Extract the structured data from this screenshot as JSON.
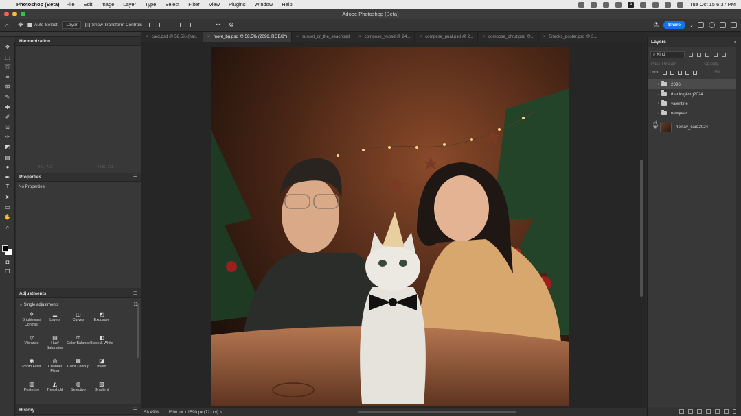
{
  "menubar": {
    "app": "Photoshop (Beta)",
    "items": [
      "File",
      "Edit",
      "mage",
      "Layer",
      "Type",
      "Select",
      "Filter",
      "View",
      "Plugins",
      "Window",
      "Help"
    ],
    "clock": "Tue Oct 15  6:37 PM"
  },
  "window": {
    "title": "Adobe Photoshop (Beta)"
  },
  "options": {
    "auto_select_label": "Auto-Select:",
    "auto_select_target": "Layer",
    "transform_label": "Show Transform Controls",
    "more": "•••",
    "share": "Share"
  },
  "tabs": [
    {
      "label": "card.psd @ 58.5% (har..."
    },
    {
      "label": "more_bg.psd @ 58.5% (2096, RGB/8*)"
    },
    {
      "label": "sunset_or_the_seachpsd"
    },
    {
      "label": "compose_yupsd @ 24..."
    },
    {
      "label": "compese_pual.psd @ 2..."
    },
    {
      "label": "comoose_chrut.psd @..."
    },
    {
      "label": "5nacks_poster.psd @ 3..."
    }
  ],
  "panels": {
    "harmonization": {
      "title": "Harmonization",
      "coord_left": "441, 712",
      "coord_right": "4446, 712"
    },
    "properties": {
      "title": "Properties",
      "empty": "No Properties"
    },
    "adjustments": {
      "title": "Adjustments",
      "section": "Single adjustments",
      "items": [
        {
          "label": "Brightness/ Contrast",
          "icon": "sun-icon",
          "glyph": "✲"
        },
        {
          "label": "Levels",
          "icon": "levels-icon",
          "glyph": "▂"
        },
        {
          "label": "Curves",
          "icon": "curves-icon",
          "glyph": "◫"
        },
        {
          "label": "Exposure",
          "icon": "exposure-icon",
          "glyph": "◩"
        },
        {
          "label": "Vibrance",
          "icon": "vibrance-icon",
          "glyph": "▽"
        },
        {
          "label": "Hue/ Saturation",
          "icon": "hue-icon",
          "glyph": "▤"
        },
        {
          "label": "Color Balance",
          "icon": "balance-icon",
          "glyph": "⚖"
        },
        {
          "label": "Black & White",
          "icon": "bw-icon",
          "glyph": "◧"
        },
        {
          "label": "Photo Filter",
          "icon": "photo-filter-icon",
          "glyph": "◉"
        },
        {
          "label": "Channel Mixer",
          "icon": "channel-mixer-icon",
          "glyph": "◎"
        },
        {
          "label": "Color Lookup",
          "icon": "color-lookup-icon",
          "glyph": "▦"
        },
        {
          "label": "Invert",
          "icon": "invert-icon",
          "glyph": "◪"
        },
        {
          "label": "Posterize",
          "icon": "posterize-icon",
          "glyph": "▥"
        },
        {
          "label": "Threshold",
          "icon": "threshold-icon",
          "glyph": "◭"
        },
        {
          "label": "Selective",
          "icon": "selective-icon",
          "glyph": "◍"
        },
        {
          "label": "Gradient",
          "icon": "gradient-icon",
          "glyph": "▧"
        }
      ]
    },
    "history": {
      "title": "History"
    }
  },
  "status": {
    "zoom": "58.49%",
    "doc": "1590 px x 1590 px (72 ppi)"
  },
  "layers": {
    "title": "Layers",
    "kind": "Kind",
    "blend": "Pass Through",
    "opacity": "Opacity:",
    "lock": "Lock:",
    "fill": "Fill:",
    "items": [
      {
        "name": "2096",
        "type": "group",
        "selected": true
      },
      {
        "name": "thanksgivirg2024",
        "type": "group",
        "selected": false
      },
      {
        "name": "valentine",
        "type": "group",
        "selected": false
      },
      {
        "name": "newyear",
        "type": "group",
        "selected": false
      },
      {
        "name": "holkav_card2024",
        "type": "image",
        "selected": false
      }
    ]
  }
}
